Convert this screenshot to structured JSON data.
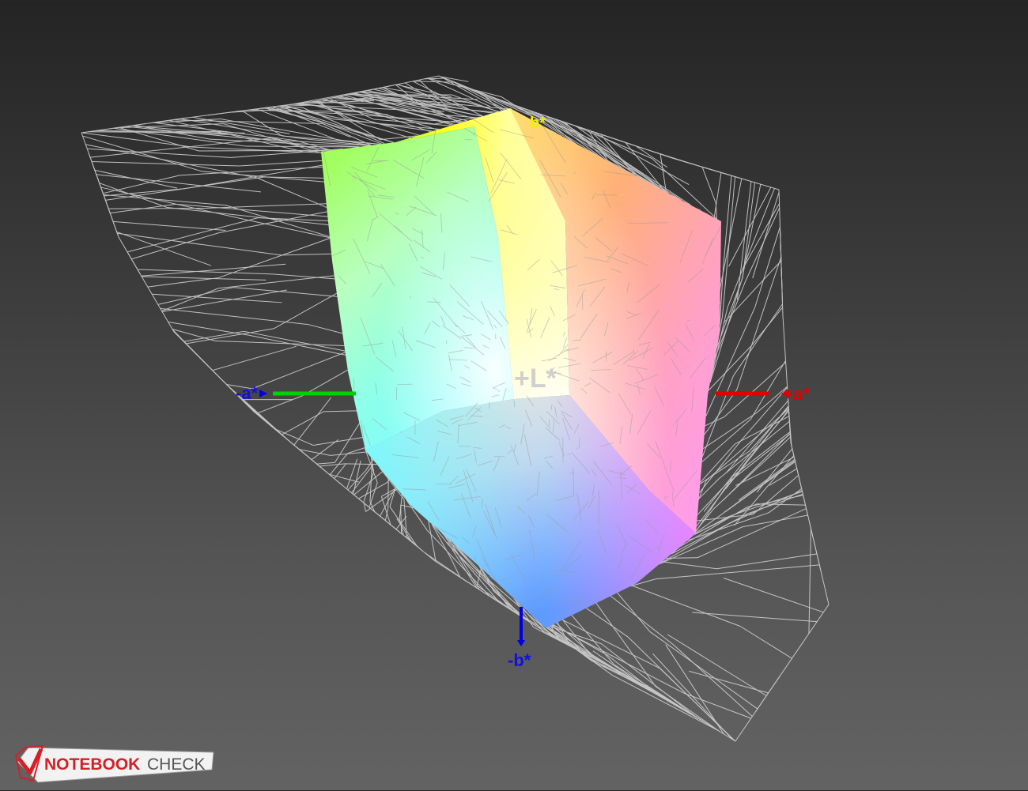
{
  "axes": {
    "plus_b": "b*",
    "minus_b": "-b*",
    "plus_a": "+a*",
    "minus_a": "-a*",
    "plus_L": "+L*"
  },
  "colors": {
    "background_top": "#242424",
    "background_bottom": "#636363",
    "wireframe": "#d9d9d9",
    "axis_red": "#e00000",
    "axis_green": "#00d000",
    "axis_blue": "#0000e0",
    "axis_yellow": "#f0f000",
    "logo_red": "#d42027"
  },
  "logo": {
    "text_notebook": "NOTEBOOK",
    "text_check": "CHECK",
    "check_icon": "checkmark-icon"
  }
}
